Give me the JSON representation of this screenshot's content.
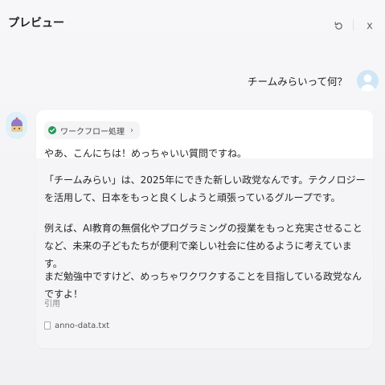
{
  "header": {
    "title": "プレビュー",
    "refresh_icon": "refresh-icon",
    "close_label": "x"
  },
  "user": {
    "message": "チームみらいって何？",
    "avatar_icon": "user-avatar-icon"
  },
  "bot": {
    "avatar_icon": "bot-avatar-icon",
    "workflow_label": "ワークフロー処理",
    "greeting": "やあ、こんにちは！めっちゃいい質問ですね。",
    "paragraphs": [
      "「チームみらい」は、2025年にできた新しい政党なんです。テクノロジーを活用して、日本をもっと良くしようと頑張っているグループです。",
      "例えば、AI教育の無償化やプログラミングの授業をもっと充実させることなど、未来の子どもたちが便利で楽しい社会に住めるように考えています。",
      "まだ勉強中ですけど、めっちゃワクワクすることを目指している政党なんですよ！"
    ],
    "citation_label": "引用",
    "citation_file": "anno-data.txt"
  },
  "colors": {
    "success": "#1f9d55",
    "user_avatar_bg": "#cfe6f6",
    "bot_avatar_bg": "#dff0f7"
  }
}
